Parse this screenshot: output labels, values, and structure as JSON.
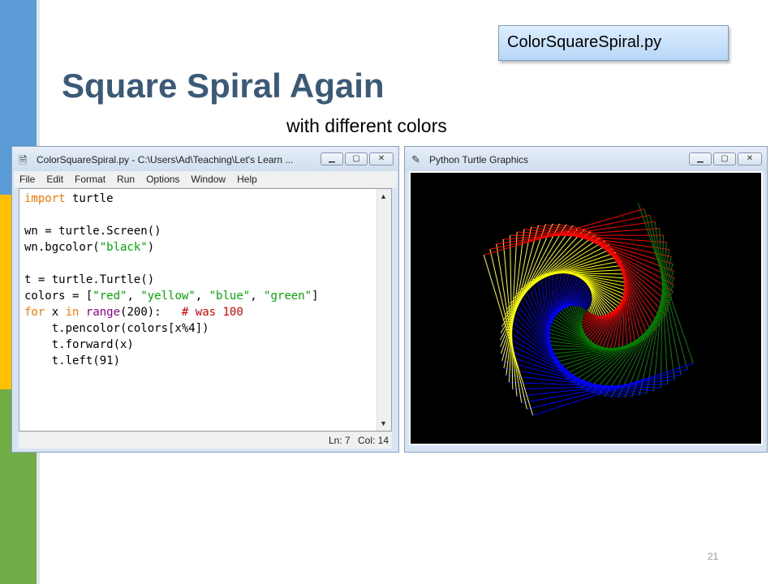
{
  "slide": {
    "file_badge": "ColorSquareSpiral.py",
    "title": "Square Spiral Again",
    "subtitle": "with different colors",
    "page_number": "21"
  },
  "idle_window": {
    "title": "ColorSquareSpiral.py - C:\\Users\\Ad\\Teaching\\Let's Learn ...",
    "menu": [
      "File",
      "Edit",
      "Format",
      "Run",
      "Options",
      "Window",
      "Help"
    ],
    "code_lines": [
      "import turtle",
      "",
      "wn = turtle.Screen()",
      "wn.bgcolor(\"black\")",
      "",
      "t = turtle.Turtle()",
      "colors = [\"red\", \"yellow\", \"blue\", \"green\"]",
      "for x in range(200):   # was 100",
      "    t.pencolor(colors[x%4])",
      "    t.forward(x)",
      "    t.left(91)"
    ],
    "status_ln": "Ln: 7",
    "status_col": "Col: 14"
  },
  "turtle_window": {
    "title": "Python Turtle Graphics",
    "spiral_colors": [
      "#ff0000",
      "#ffff00",
      "#0000ff",
      "#008000"
    ]
  },
  "colors": {
    "title": "#3b5a78",
    "bar_blue": "#5b9bd5",
    "bar_yellow": "#ffc000",
    "bar_green": "#70ad47"
  },
  "icons": [
    "minimize-icon",
    "maximize-icon",
    "close-icon",
    "scroll-up-icon",
    "scroll-down-icon",
    "feather-icon"
  ]
}
